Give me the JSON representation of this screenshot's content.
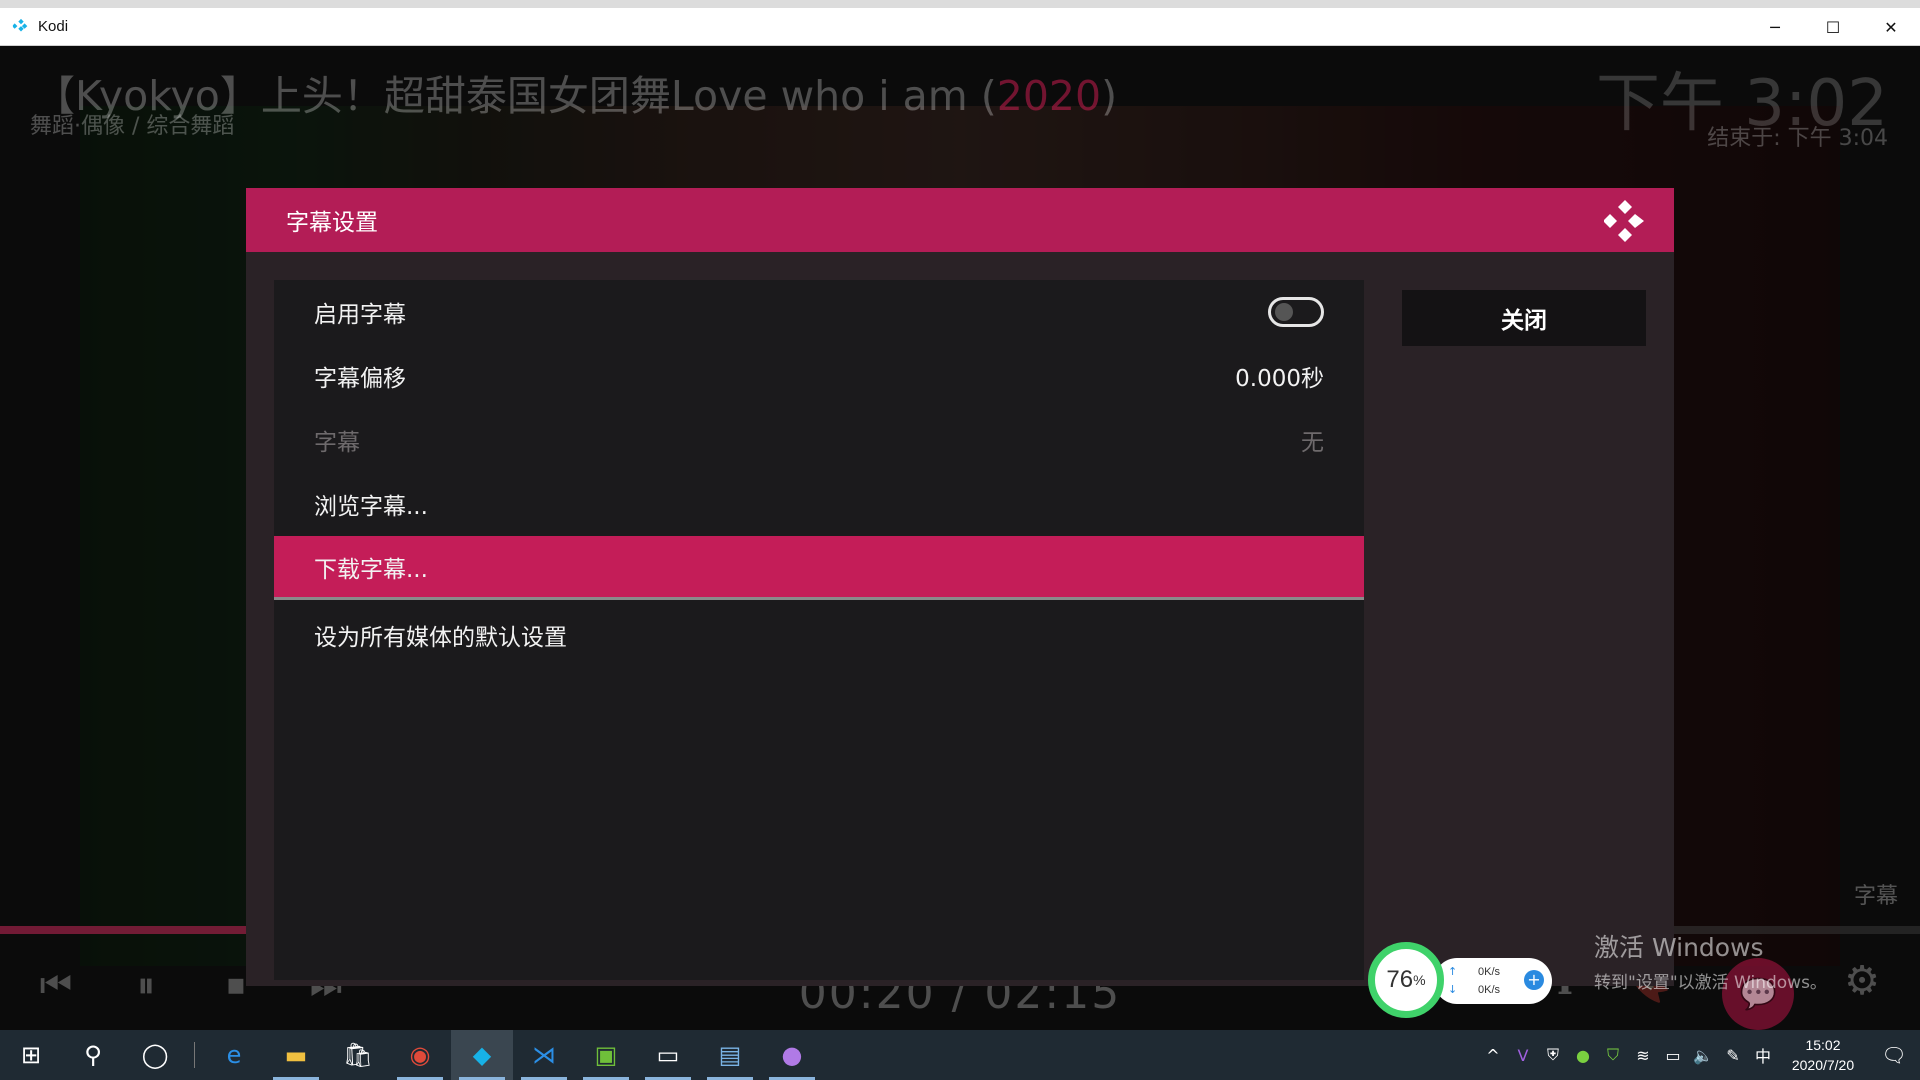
{
  "window": {
    "title": "Kodi",
    "controls": {
      "minimize": "─",
      "maximize": "☐",
      "close": "✕"
    }
  },
  "osd": {
    "title_prefix": "【Kyokyo】上头！超甜泰国女团舞Love who i am (",
    "year": "2020",
    "title_suffix": ")",
    "genre": "舞蹈·偶像 / 综合舞蹈",
    "clock": "下午 3:02",
    "end_time": "结束于: 下午 3:04",
    "subtitle_label": "字幕",
    "time": "00:20 / 02:15",
    "progress_fraction": 0.148
  },
  "dialog": {
    "title": "字幕设置",
    "close_label": "关闭",
    "rows": [
      {
        "label": "启用字幕",
        "value": "",
        "type": "toggle",
        "enabled": false
      },
      {
        "label": "字幕偏移",
        "value": "0.000秒"
      },
      {
        "label": "字幕",
        "value": "无",
        "disabled": true
      },
      {
        "label": "浏览字幕...",
        "value": ""
      },
      {
        "label": "下载字幕...",
        "value": "",
        "selected": true
      },
      {
        "label": "设为所有媒体的默认设置",
        "value": ""
      }
    ]
  },
  "net_widget": {
    "percent": "76",
    "percent_sign": "%",
    "up_speed": "0K/s",
    "down_speed": "0K/s"
  },
  "watermark": {
    "line1": "激活 Windows",
    "line2": "转到\"设置\"以激活 Windows。"
  },
  "taskbar": {
    "clock_time": "15:02",
    "clock_date": "2020/7/20",
    "ime": "中"
  },
  "colors": {
    "accent": "#c41d58",
    "header": "#b31d56",
    "dialog_bg": "#2a2226",
    "list_bg": "#1b1a1c"
  }
}
